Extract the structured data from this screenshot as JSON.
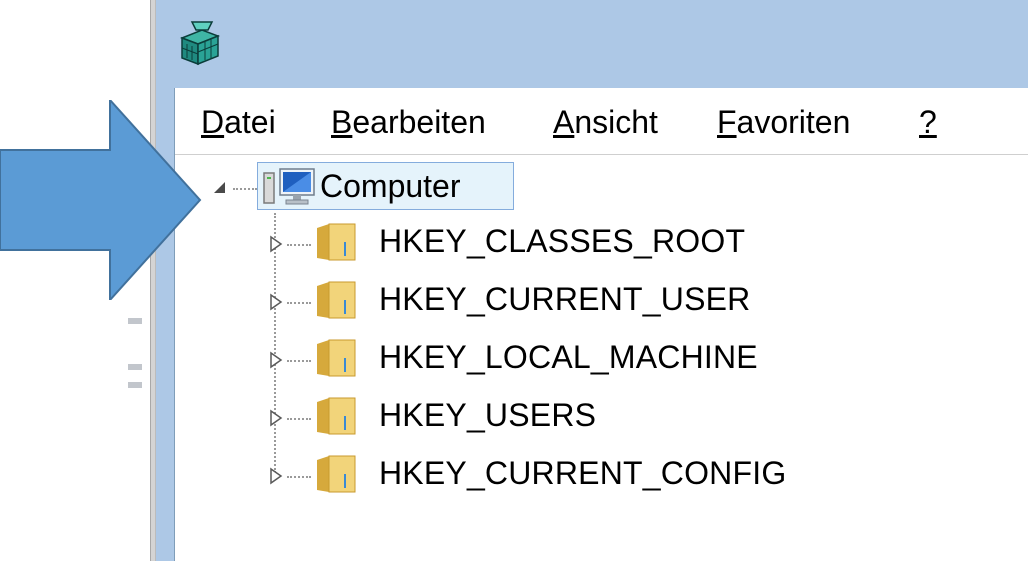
{
  "window": {
    "menu": [
      {
        "underline": "D",
        "rest": "atei"
      },
      {
        "underline": "B",
        "rest": "earbeiten"
      },
      {
        "underline": "A",
        "rest": "nsicht"
      },
      {
        "underline": "F",
        "rest": "avoriten"
      },
      {
        "underline": "?",
        "rest": ""
      }
    ]
  },
  "tree": {
    "root": {
      "label": "Computer",
      "icon": "computer-icon",
      "expanded": true,
      "selected": true
    },
    "children": [
      {
        "label": "HKEY_CLASSES_ROOT",
        "icon": "folder-icon"
      },
      {
        "label": "HKEY_CURRENT_USER",
        "icon": "folder-icon"
      },
      {
        "label": "HKEY_LOCAL_MACHINE",
        "icon": "folder-icon"
      },
      {
        "label": "HKEY_USERS",
        "icon": "folder-icon"
      },
      {
        "label": "HKEY_CURRENT_CONFIG",
        "icon": "folder-icon"
      }
    ]
  },
  "annotation": {
    "icon": "arrow-right-icon",
    "color": "#5b9bd5",
    "border": "#41719c"
  },
  "colors": {
    "titlebar": "#adc8e6",
    "selection_bg": "#e5f3fb",
    "selection_border": "#84acdd",
    "folder": "#e8c25a"
  }
}
